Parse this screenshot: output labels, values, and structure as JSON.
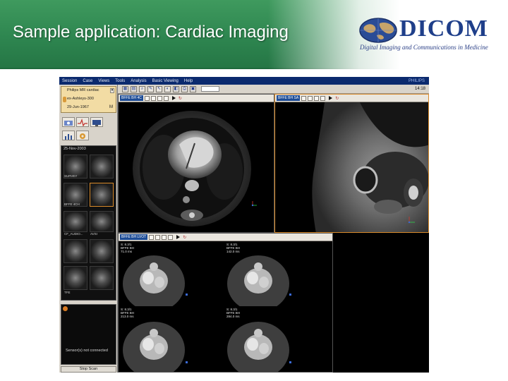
{
  "slide": {
    "title": "Sample application: Cardiac Imaging",
    "logo_word": "DICOM",
    "logo_tagline": "Digital Imaging and Communications in Medicine"
  },
  "app": {
    "menu": [
      "Session",
      "Case",
      "Views",
      "Tools",
      "Analysis",
      "Basic Viewing",
      "Help"
    ],
    "brand": "PHILIPS",
    "clock": "14:18",
    "patient": {
      "system": "Philips MR cardiac",
      "name": "ex-Ashleys-300",
      "birth_date": "29-Jun-1967",
      "sex": "M"
    },
    "tray_date": "25-Nov-2003",
    "thumbnails": [
      "SURVEY",
      "",
      "BFFE 4CH",
      "",
      "CF_AUDIO...",
      "AVSI",
      "",
      "",
      "TFE",
      ""
    ],
    "status_text": "Sensor(s) not connected",
    "stop_button": "Stop Scan",
    "viewports": {
      "top_left": "BFFE BH 4C",
      "top_right": "BFFE BH SA",
      "bottom_left": "BFFE BH LVOT"
    },
    "mini_frames": [
      {
        "line1": "S: 8.3/1",
        "line2": "BFFE BH",
        "line3": "71.0 ms"
      },
      {
        "line1": "S: 8.3/1",
        "line2": "BFFE BH",
        "line3": "142.0 ms"
      },
      {
        "line1": "S: 8.3/1",
        "line2": "BFFE BH",
        "line3": "213.0 ms"
      },
      {
        "line1": "S: 8.3/1",
        "line2": "BFFE BH",
        "line3": "284.0 ms"
      }
    ]
  },
  "colors": {
    "header_green": "#2e8650",
    "menu_blue": "#0b2a6e",
    "active_border": "#d98a2a",
    "patient_panel": "#f2dca4",
    "logo_blue": "#1f3f8a"
  }
}
